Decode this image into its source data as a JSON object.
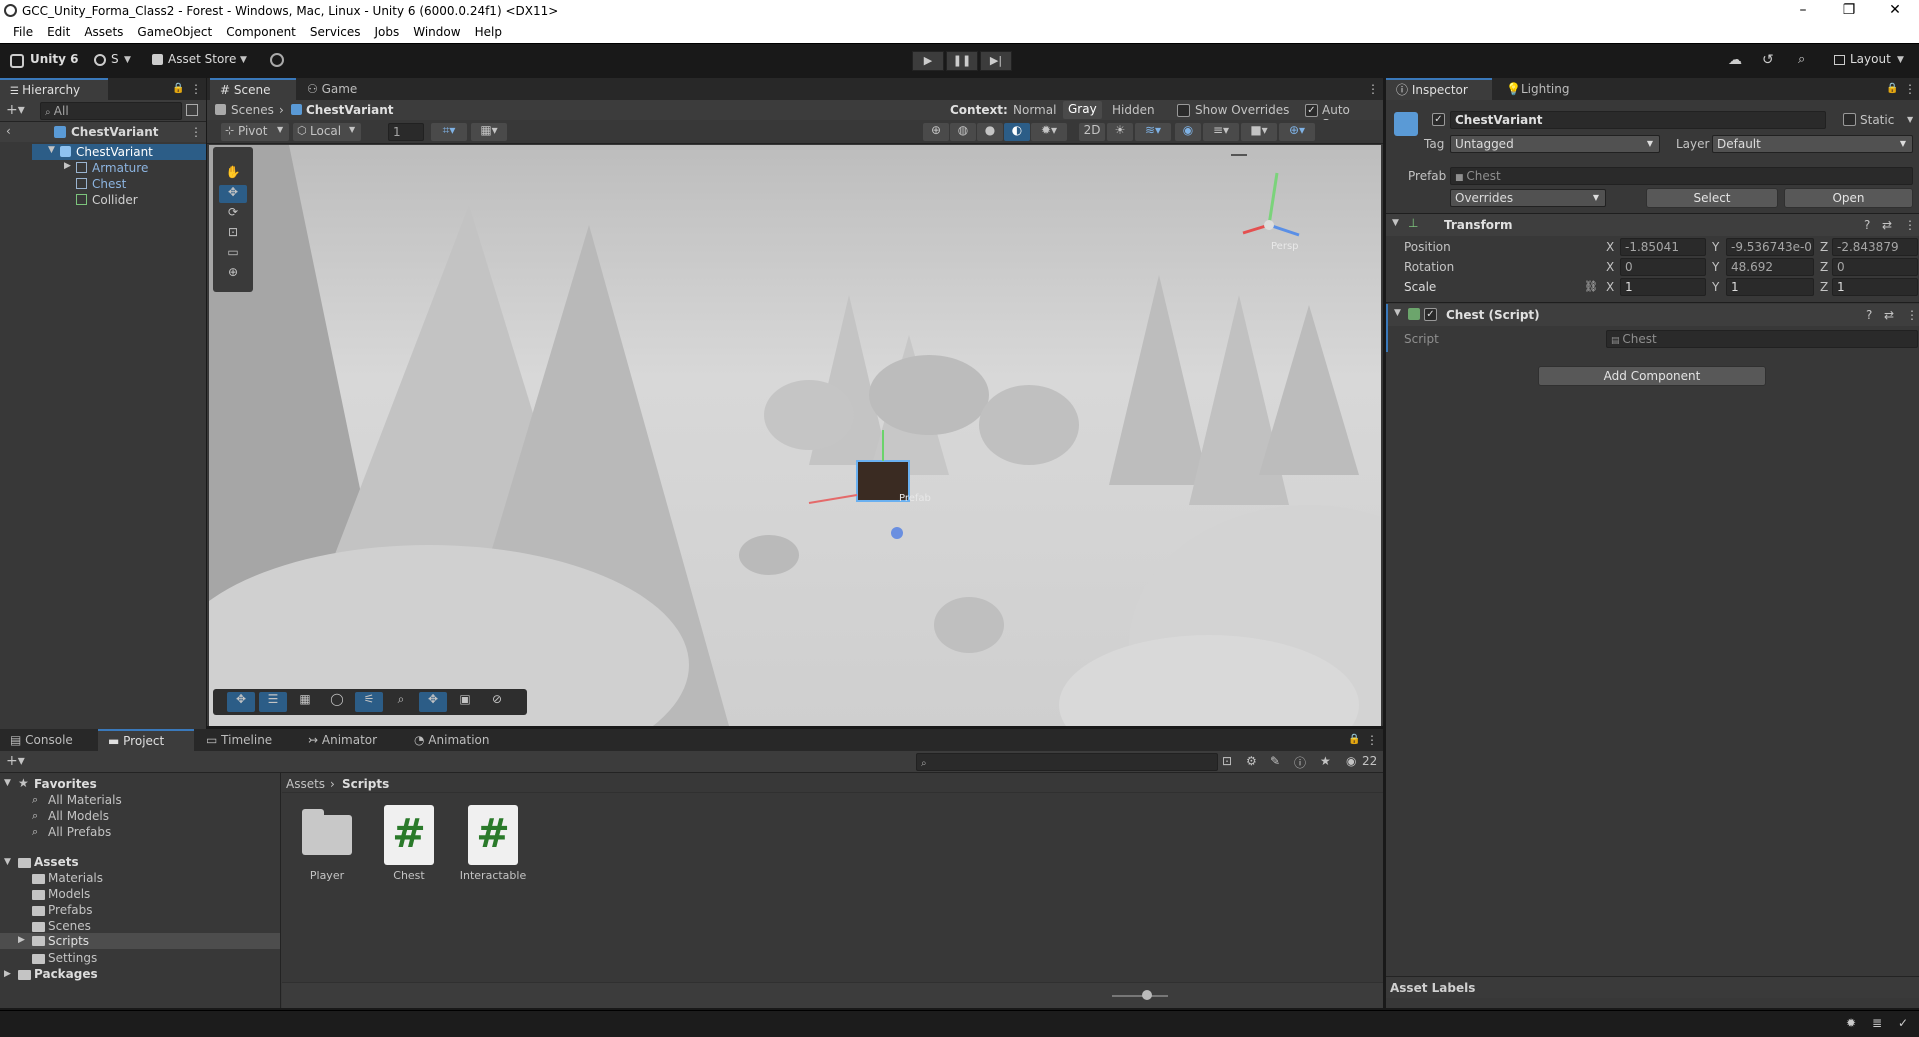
{
  "window": {
    "title": "GCC_Unity_Forma_Class2 - Forest - Windows, Mac, Linux - Unity 6 (6000.0.24f1) <DX11>",
    "minimize": "–",
    "maximize": "❐",
    "close": "✕"
  },
  "menu": [
    "File",
    "Edit",
    "Assets",
    "GameObject",
    "Component",
    "Services",
    "Jobs",
    "Window",
    "Help"
  ],
  "toolbar": {
    "unity_label": "Unity 6",
    "account_label": "S",
    "asset_store_label": "Asset Store",
    "layout_label": "Layout"
  },
  "hierarchy": {
    "tab": "Hierarchy",
    "search_placeholder": "All",
    "root": "ChestVariant",
    "selected": "ChestVariant",
    "children": [
      "Armature",
      "Chest",
      "Collider"
    ]
  },
  "scene": {
    "tab_scene": "Scene",
    "tab_game": "Game",
    "breadcrumb_root": "Scenes",
    "breadcrumb_current": "ChestVariant",
    "context_label": "Context:",
    "context_options": [
      "Normal",
      "Gray",
      "Hidden"
    ],
    "context_selected": "Gray",
    "show_overrides": "Show Overrides",
    "auto_save": "Auto Save",
    "pivot": "Pivot",
    "local": "Local",
    "grid_value": "1",
    "persp_label": "Persp",
    "prefab_label": "Prefab"
  },
  "inspector": {
    "tab_inspector": "Inspector",
    "tab_lighting": "Lighting",
    "object_name": "ChestVariant",
    "static_label": "Static",
    "tag_label": "Tag",
    "tag_value": "Untagged",
    "layer_label": "Layer",
    "layer_value": "Default",
    "prefab_label": "Prefab",
    "prefab_value": "Chest",
    "overrides": "Overrides",
    "select_btn": "Select",
    "open_btn": "Open",
    "transform_title": "Transform",
    "position_label": "Position",
    "rotation_label": "Rotation",
    "scale_label": "Scale",
    "position": {
      "x": "-1.85041",
      "y": "-9.536743e-0",
      "z": "-2.843879"
    },
    "rotation": {
      "x": "0",
      "y": "48.692",
      "z": "0"
    },
    "scale": {
      "x": "1",
      "y": "1",
      "z": "1"
    },
    "script_component": "Chest (Script)",
    "script_label": "Script",
    "script_value": "Chest",
    "add_component": "Add Component",
    "asset_labels": "Asset Labels",
    "axis_x": "X",
    "axis_y": "Y",
    "axis_z": "Z"
  },
  "bottom": {
    "tabs": [
      "Console",
      "Project",
      "Timeline",
      "Animator",
      "Animation"
    ],
    "active_tab": "Project",
    "favorites": "Favorites",
    "favorites_items": [
      "All Materials",
      "All Models",
      "All Prefabs"
    ],
    "assets": "Assets",
    "assets_items": [
      "Materials",
      "Models",
      "Prefabs",
      "Scenes",
      "Scripts",
      "Settings"
    ],
    "packages": "Packages",
    "path_root": "Assets",
    "path_current": "Scripts",
    "hidden_count": "22",
    "files": [
      {
        "name": "Player",
        "type": "folder"
      },
      {
        "name": "Chest",
        "type": "script"
      },
      {
        "name": "Interactable",
        "type": "script"
      }
    ],
    "script_glyph": "#"
  }
}
